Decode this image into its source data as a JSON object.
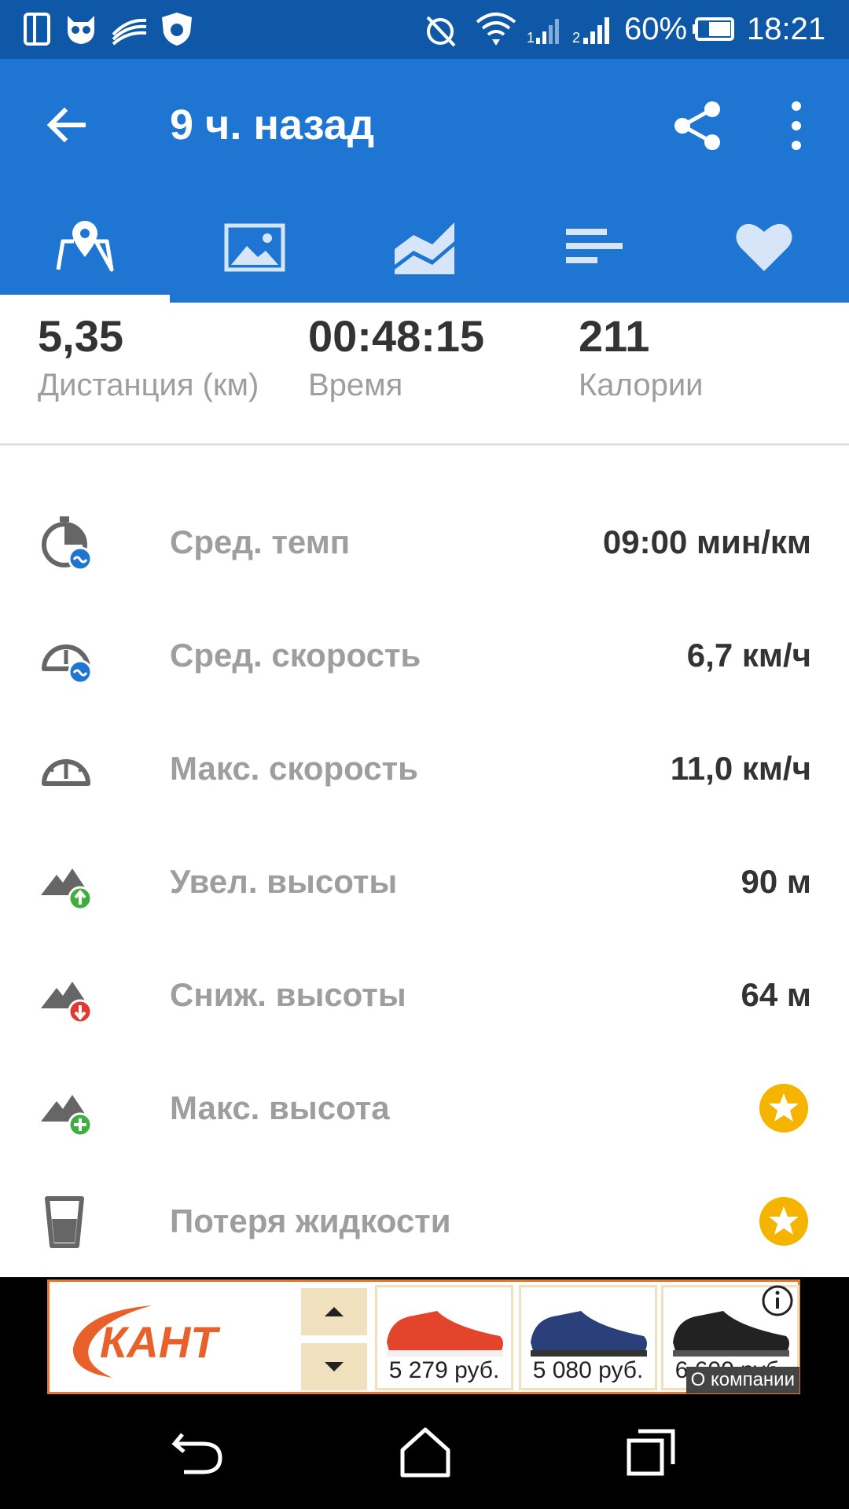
{
  "status_bar": {
    "battery_percent": "60%",
    "time": "18:21",
    "icons": [
      "phone-layout-icon",
      "owl-icon",
      "swiftkey-icon",
      "antivirus-icon",
      "alarm-off-icon",
      "wifi-icon",
      "signal-1-icon",
      "signal-2-icon",
      "battery-icon"
    ]
  },
  "app_bar": {
    "title": "9 ч. назад",
    "icons": [
      "back-arrow-icon",
      "share-icon",
      "more-vert-icon"
    ]
  },
  "tabs": [
    {
      "name": "map",
      "icon": "map-pin-icon",
      "active": true
    },
    {
      "name": "photos",
      "icon": "image-icon",
      "active": false
    },
    {
      "name": "charts",
      "icon": "area-chart-icon",
      "active": false
    },
    {
      "name": "splits",
      "icon": "bars-icon",
      "active": false
    },
    {
      "name": "likes",
      "icon": "heart-icon",
      "active": false
    }
  ],
  "summary": {
    "distance": {
      "value": "5,35",
      "label": "Дистанция (км)"
    },
    "time": {
      "value": "00:48:15",
      "label": "Время"
    },
    "calories": {
      "value": "211",
      "label": "Калории"
    }
  },
  "stats": [
    {
      "label": "Сред. темп",
      "value": "09:00 мин/км",
      "icon": "stopwatch-avg-icon"
    },
    {
      "label": "Сред. скорость",
      "value": "6,7 км/ч",
      "icon": "speedometer-avg-icon"
    },
    {
      "label": "Макс. скорость",
      "value": "11,0 км/ч",
      "icon": "speedometer-icon"
    },
    {
      "label": "Увел. высоты",
      "value": "90 м",
      "icon": "elevation-up-icon"
    },
    {
      "label": "Сниж. высоты",
      "value": "64 м",
      "icon": "elevation-down-icon"
    },
    {
      "label": "Макс. высота",
      "value": "",
      "icon": "elevation-max-icon",
      "premium": true
    },
    {
      "label": "Потеря жидкости",
      "value": "",
      "icon": "glass-icon",
      "premium": true
    }
  ],
  "ad": {
    "brand": "КАНТ",
    "products": [
      {
        "price": "5 279 руб.",
        "color": "#e2452b"
      },
      {
        "price": "5 080 руб.",
        "color": "#2b3f7a"
      },
      {
        "price": "6 600 руб.",
        "color": "#222222"
      }
    ],
    "about_label": "О компании"
  },
  "nav_bar": {
    "icons": [
      "nav-back-icon",
      "nav-home-icon",
      "nav-recents-icon"
    ]
  },
  "colors": {
    "status_bar": "#0f58a8",
    "app_bar": "#1e76d2",
    "premium_star": "#f4b400",
    "ad_border": "#e8772e"
  }
}
